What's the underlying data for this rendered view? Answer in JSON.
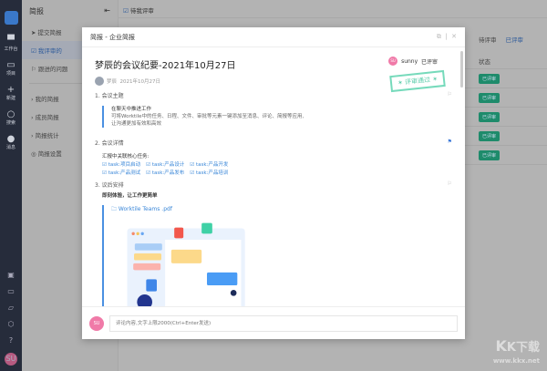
{
  "rail": {
    "items": [
      {
        "label": "工作台",
        "icon": "briefcase-icon"
      },
      {
        "label": "项目",
        "icon": "inbox-icon"
      },
      {
        "label": "新建",
        "icon": "plus-icon"
      },
      {
        "label": "搜索",
        "icon": "search-icon"
      },
      {
        "label": "消息",
        "icon": "chat-icon"
      }
    ],
    "avatar": "SU"
  },
  "side": {
    "title": "简报",
    "items": [
      "提交简报",
      "我评审的",
      "跟进的问题"
    ],
    "groups": [
      "我的简报",
      "成员简报",
      "简报统计"
    ],
    "settings": "简报设置"
  },
  "topbar": {
    "filter": "待我评审"
  },
  "right": {
    "tabs": [
      "待评审",
      "已评审"
    ],
    "status_header": "状态",
    "badges": [
      "已评审",
      "已评审",
      "已评审",
      "已评审",
      "已评审"
    ]
  },
  "modal": {
    "title": "简报 - 企业简报",
    "report_title": "梦辰的会议纪要-2021年10月27日",
    "author": "梦辰",
    "date": "2021年10月27日",
    "reviewer": {
      "avatar": "SU",
      "name": "sunny",
      "status": "已评审"
    },
    "stamp": "评审通过",
    "sections": [
      {
        "heading": "1. 会议主题",
        "quote_title": "在聊天中推进工作",
        "quote_lines": [
          "可将Worktile中的任务、日程、文件、审批等元素一键添加至消息、评论、简报等应用,",
          "让沟通更加有效和高效"
        ]
      },
      {
        "heading": "2. 会议详情",
        "intro": "汇报中关联核心任务:",
        "tasks": [
          "task:项目启动",
          "task:产品设计",
          "task:产品开发",
          "task:产品测试",
          "task:产品发布",
          "task:产品培训"
        ]
      },
      {
        "heading": "3. 议后安排",
        "bold": "即刻体验，让工作更简单",
        "attachment": "Worktile Teams .pdf"
      }
    ],
    "comment_avatar": "SU",
    "comment_placeholder": "评论内容,文字上限2000(Ctrl+Enter发送)"
  },
  "watermark": {
    "logo": "KK下载",
    "url": "www.kkx.net"
  }
}
